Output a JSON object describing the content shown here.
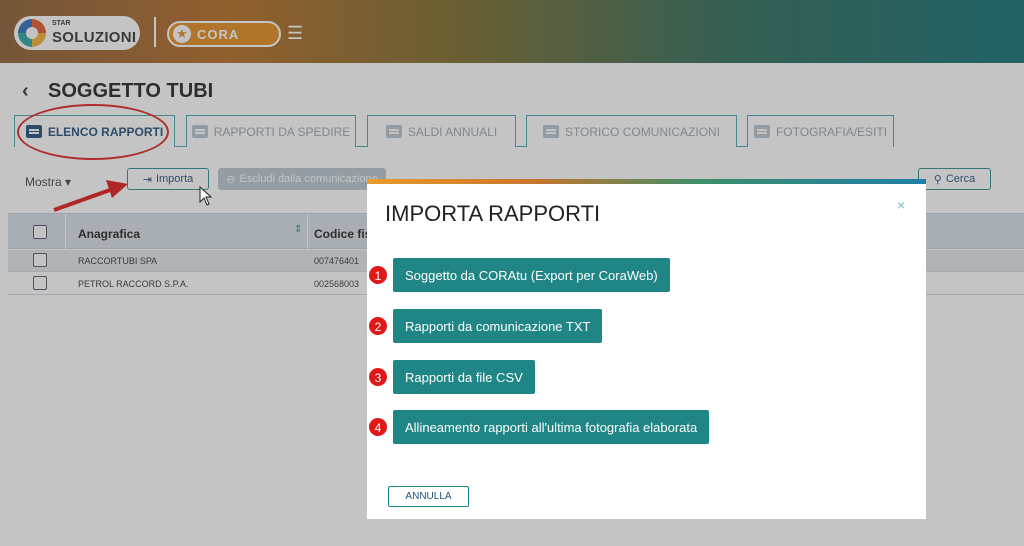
{
  "header": {
    "logo_small": "STAR",
    "logo_big": "SOLUZIONI",
    "app_name": "CORA",
    "menu_icon": "hamburger-icon"
  },
  "page": {
    "title": "SOGGETTO TUBI"
  },
  "tabs": [
    {
      "label": "ELENCO RAPPORTI",
      "active": true
    },
    {
      "label": "RAPPORTI DA SPEDIRE",
      "active": false
    },
    {
      "label": "SALDI ANNUALI",
      "active": false
    },
    {
      "label": "STORICO COMUNICAZIONI",
      "active": false
    },
    {
      "label": "FOTOGRAFIA/ESITI",
      "active": false
    }
  ],
  "toolbar": {
    "mostra": "Mostra",
    "importa": "Importa",
    "escludi": "Escludi dalla comunicazione",
    "cerca": "Cerca"
  },
  "table": {
    "headers": [
      "Anagrafica",
      "Codice fisc"
    ],
    "rows": [
      {
        "anagrafica": "RACCORTUBI SPA",
        "codice": "007476401"
      },
      {
        "anagrafica": "PETROL RACCORD S.P.A.",
        "codice": "002568003"
      }
    ]
  },
  "modal": {
    "title": "IMPORTA RAPPORTI",
    "close": "×",
    "options": [
      {
        "num": "1",
        "label": "Soggetto da CORAtu (Export per CoraWeb)"
      },
      {
        "num": "2",
        "label": "Rapporti da comunicazione TXT"
      },
      {
        "num": "3",
        "label": "Rapporti da file CSV"
      },
      {
        "num": "4",
        "label": "Allineamento rapporti all'ultima fotografia elaborata"
      }
    ],
    "cancel": "ANNULLA"
  },
  "colors": {
    "accent": "#208585",
    "annotation": "#e01818",
    "header_bg": "#d6dfe6"
  }
}
